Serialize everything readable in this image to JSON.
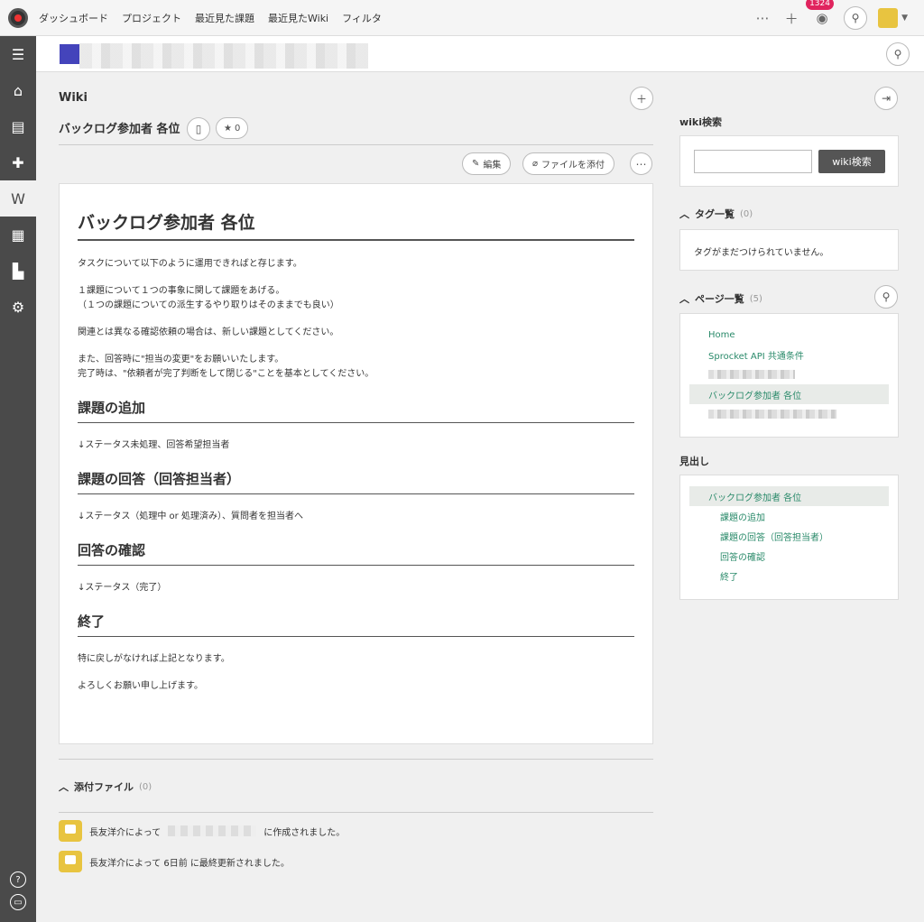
{
  "topnav": {
    "items": [
      "ダッシュボード",
      "プロジェクト",
      "最近見た課題",
      "最近見たWiki",
      "フィルタ"
    ],
    "notification_count": "1324"
  },
  "main": {
    "section_label": "Wiki",
    "page_title": "バックログ参加者 各位",
    "star_count": "0",
    "edit_label": "編集",
    "attach_label": "ファイルを添付",
    "doc": {
      "h1": "バックログ参加者 各位",
      "intro1": "タスクについて以下のように運用できればと存じます。",
      "intro2a": "１課題について１つの事象に関して課題をあげる。",
      "intro2b": "（１つの課題についての派生するやり取りはそのままでも良い）",
      "intro3": "関連とは異なる確認依頼の場合は、新しい課題としてください。",
      "intro4a": "また、回答時に\"担当の変更\"をお願いいたします。",
      "intro4b": "完了時は、\"依頼者が完了判断をして閉じる\"ことを基本としてください。",
      "s1_title": "課題の追加",
      "s1_body": "↓ステータス未処理、回答希望担当者",
      "s2_title": "課題の回答（回答担当者）",
      "s2_body": "↓ステータス（処理中 or 処理済み）、質問者を担当者へ",
      "s3_title": "回答の確認",
      "s3_body": "↓ステータス（完了）",
      "s4_title": "終了",
      "s4_body1": "特に戻しがなければ上記となります。",
      "s4_body2": "よろしくお願い申し上げます。"
    },
    "attachments_label": "添付ファイル",
    "attachments_count": "(0)",
    "history": {
      "created_prefix": "長友洋介によって",
      "created_suffix": "に作成されました。",
      "updated": "長友洋介によって 6日前 に最終更新されました。"
    }
  },
  "right": {
    "search_title": "wiki検索",
    "search_button": "wiki検索",
    "tags_title": "タグ一覧",
    "tags_count": "(0)",
    "tags_empty": "タグがまだつけられていません。",
    "pages_title": "ページ一覧",
    "pages_count": "(5)",
    "pages": [
      "Home",
      "Sprocket API 共通条件",
      "バックログ参加者 各位"
    ],
    "headings_title": "見出し",
    "headings": [
      "バックログ参加者 各位",
      "課題の追加",
      "課題の回答（回答担当者）",
      "回答の確認",
      "終了"
    ]
  }
}
